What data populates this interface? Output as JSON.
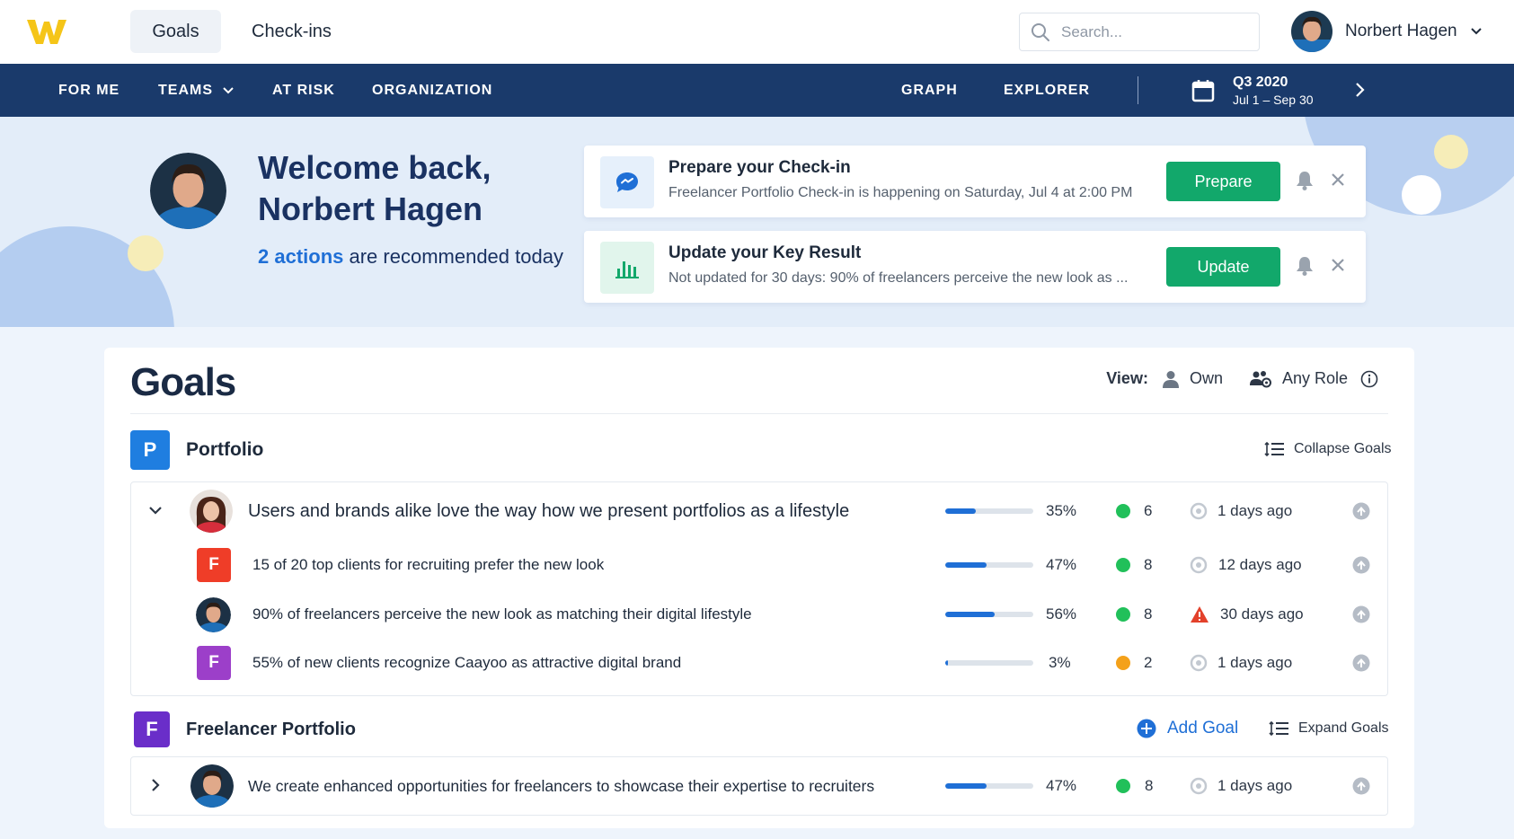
{
  "topbar": {
    "tabs": [
      "Goals",
      "Check-ins"
    ],
    "search_placeholder": "Search...",
    "user_name": "Norbert Hagen"
  },
  "nav": {
    "items": [
      "FOR ME",
      "TEAMS",
      "AT RISK",
      "ORGANIZATION",
      "GRAPH",
      "EXPLORER"
    ],
    "quarter": "Q3 2020",
    "quarter_range": "Jul 1 – Sep 30"
  },
  "hero": {
    "welcome_line1": "Welcome back,",
    "welcome_line2": "Norbert Hagen",
    "actions_link": "2 actions",
    "actions_rest": " are recommended today"
  },
  "cards": [
    {
      "title": "Prepare your Check-in",
      "subtitle": "Freelancer Portfolio Check-in is happening on Saturday, Jul 4 at 2:00 PM",
      "button": "Prepare",
      "icon": "chat-bubble-icon"
    },
    {
      "title": "Update your Key Result",
      "subtitle": "Not updated for 30 days: 90% of freelancers perceive the new look as ...",
      "button": "Update",
      "icon": "bar-chart-icon"
    }
  ],
  "goals": {
    "title": "Goals",
    "view_label": "View:",
    "view_own": "Own",
    "view_role": "Any Role",
    "groups": [
      {
        "badge": "P",
        "name": "Portfolio",
        "action": "Collapse Goals",
        "rows": [
          {
            "text": "Users and brands alike love the way how we present portfolios as a lifestyle",
            "progress": 35,
            "pct": "35%",
            "confidence": "green",
            "count": "6",
            "status": "neutral",
            "updated": "1 days ago"
          },
          {
            "badge": "F",
            "badge_color": "#ef3d28",
            "text": "15 of 20 top clients for recruiting prefer the new look",
            "progress": 47,
            "pct": "47%",
            "confidence": "green",
            "count": "8",
            "status": "neutral",
            "updated": "12 days ago"
          },
          {
            "text": "90% of freelancers perceive the new look as matching their digital lifestyle",
            "progress": 56,
            "pct": "56%",
            "confidence": "green",
            "count": "8",
            "status": "warning",
            "updated": "30 days ago"
          },
          {
            "badge": "F",
            "badge_color": "#9c3fc9",
            "text": "55% of new clients recognize Caayoo as attractive digital brand",
            "progress": 3,
            "pct": "3%",
            "confidence": "orange",
            "count": "2",
            "status": "neutral",
            "updated": "1 days ago"
          }
        ]
      },
      {
        "badge": "F",
        "name": "Freelancer Portfolio",
        "add_goal": "Add Goal",
        "action": "Expand Goals",
        "rows": [
          {
            "text": "We create enhanced opportunities for freelancers to showcase their expertise to recruiters",
            "progress": 47,
            "pct": "47%",
            "confidence": "green",
            "count": "8",
            "status": "neutral",
            "updated": "1 days ago"
          }
        ]
      }
    ]
  },
  "colors": {
    "navy": "#1a3a6b",
    "green": "#12a86b",
    "blue": "#1f6fd6",
    "confidence_green": "#21c05a",
    "confidence_orange": "#f4a11a",
    "warning_red": "#e3412b"
  }
}
